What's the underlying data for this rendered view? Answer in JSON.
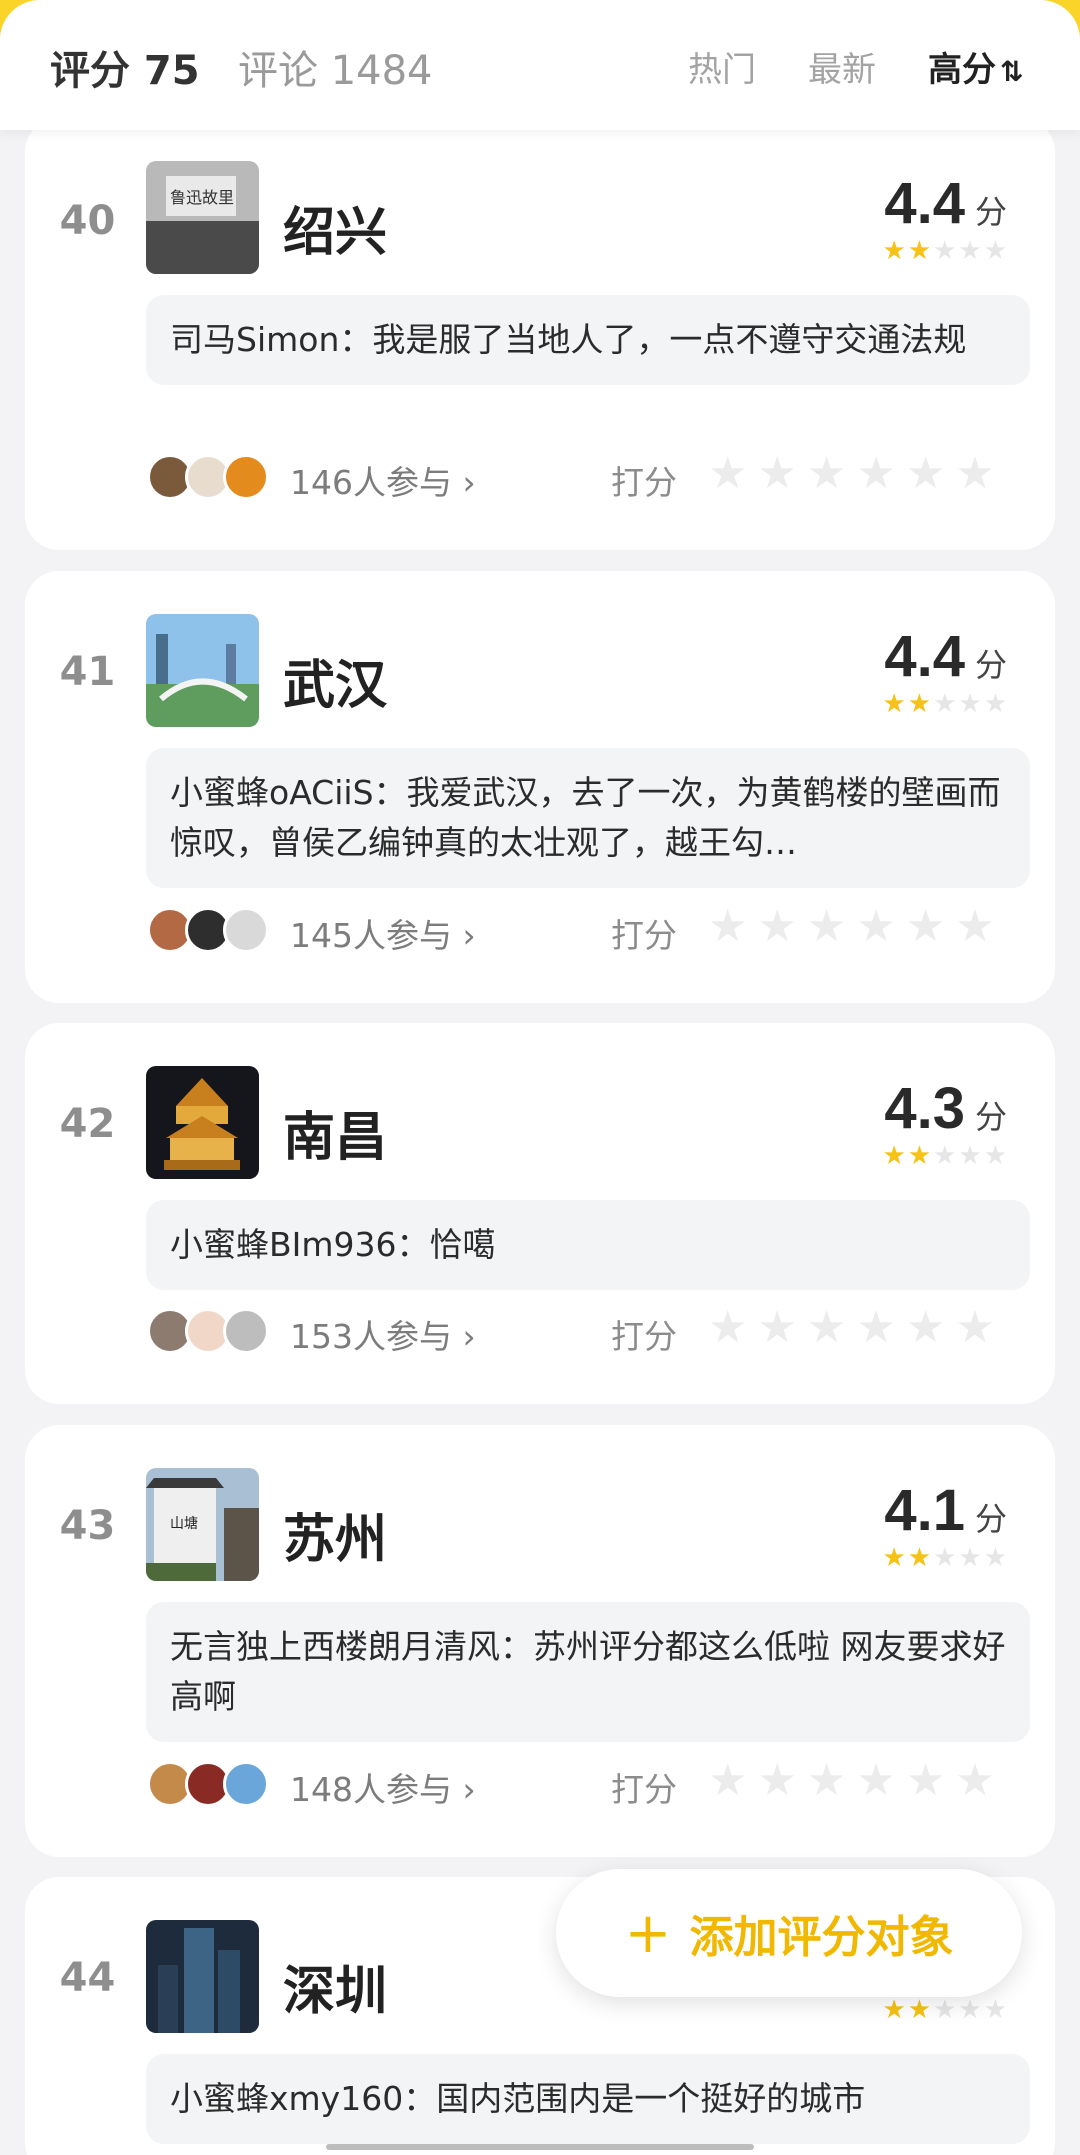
{
  "header": {
    "score_tab": "评分 75",
    "comments_tab": "评论 1484",
    "sort_hot": "热门",
    "sort_new": "最新",
    "sort_high": "高分",
    "sort_icon": "⇅"
  },
  "items": [
    {
      "rank": "40",
      "name": "绍兴",
      "score": "4.4",
      "unit": "分",
      "stars_on": 2,
      "comment": "司马Simon：我是服了当地人了，一点不遵守交通法规",
      "participants": "146人参与 ›",
      "rate_label": "打分",
      "thumb_colors": [
        "#3a3a3a",
        "#a8a8a8"
      ],
      "avatar_colors": [
        "#7a5a3a",
        "#e8dccf",
        "#e38b1c"
      ]
    },
    {
      "rank": "41",
      "name": "武汉",
      "score": "4.4",
      "unit": "分",
      "stars_on": 2,
      "comment": "小蜜蜂oACiiS：我爱武汉，去了一次，为黄鹤楼的壁画而惊叹，曾侯乙编钟真的太壮观了，越王勾…",
      "participants": "145人参与 ›",
      "rate_label": "打分",
      "thumb_colors": [
        "#4f8ec9",
        "#6aa56a"
      ],
      "avatar_colors": [
        "#b36a44",
        "#2e2e2e",
        "#d9d9d9"
      ]
    },
    {
      "rank": "42",
      "name": "南昌",
      "score": "4.3",
      "unit": "分",
      "stars_on": 2,
      "comment": "小蜜蜂BIm936：恰噶",
      "participants": "153人参与 ›",
      "rate_label": "打分",
      "thumb_colors": [
        "#1a1a22",
        "#d89b2c"
      ],
      "avatar_colors": [
        "#8d7b70",
        "#f0d7c8",
        "#bdbdbd"
      ]
    },
    {
      "rank": "43",
      "name": "苏州",
      "score": "4.1",
      "unit": "分",
      "stars_on": 2,
      "comment": "无言独上西楼朗月清风：苏州评分都这么低啦 网友要求好高啊",
      "participants": "148人参与 ›",
      "rate_label": "打分",
      "thumb_colors": [
        "#9cb0c4",
        "#5e5a52"
      ],
      "avatar_colors": [
        "#c48a4a",
        "#8a2a24",
        "#6aa6d9"
      ]
    },
    {
      "rank": "44",
      "name": "深圳",
      "score": "",
      "unit": "",
      "stars_on": 2,
      "comment": "小蜜蜂xmy160：国内范围内是一个挺好的城市",
      "participants": "",
      "rate_label": "",
      "thumb_colors": [
        "#1b2a3a",
        "#3d6a8a"
      ],
      "avatar_colors": []
    }
  ],
  "add_button": {
    "label": "添加评分对象",
    "icon": "+"
  },
  "colors": {
    "accent": "#f6c215",
    "brand_yellow": "#fbd42a"
  }
}
